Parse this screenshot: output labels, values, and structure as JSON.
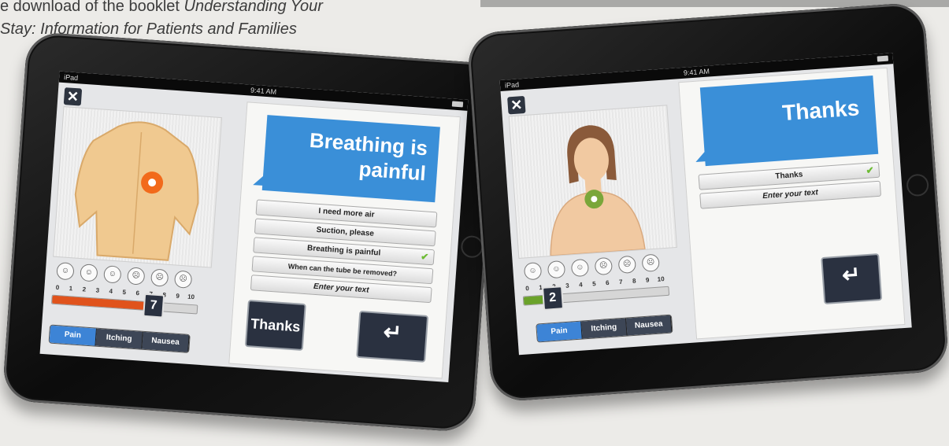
{
  "caption": {
    "line1": "e download of the booklet ",
    "line1_italic": "Understanding Your",
    "line2_italic": "Stay: Information for Patients and Families"
  },
  "left_ipad": {
    "status": {
      "carrier": "iPad",
      "time": "9:41 AM"
    },
    "close_icon": "✕",
    "face_icons": [
      "☺",
      "☺",
      "☺",
      "☹",
      "☹",
      "☹"
    ],
    "scale_numbers": [
      "0",
      "1",
      "2",
      "3",
      "4",
      "5",
      "6",
      "7",
      "8",
      "9",
      "10"
    ],
    "scale_value": 7,
    "scale_color": "#e0531c",
    "tabs": [
      "Pain",
      "Itching",
      "Nausea"
    ],
    "active_tab": "Pain",
    "bubble_text_line1": "Breathing is",
    "bubble_text_line2": "painful",
    "options": [
      "I need more air",
      "Suction, please",
      "Breathing is painful",
      "When can the tube be removed?",
      "Enter your text"
    ],
    "checked_option": "Breathing is painful",
    "thanks_button": "Thanks",
    "back_icon": "return-arrow"
  },
  "right_ipad": {
    "status": {
      "time": "9:41 AM"
    },
    "close_icon": "✕",
    "face_icons": [
      "☺",
      "☺",
      "☺",
      "☹",
      "☹",
      "☹"
    ],
    "scale_numbers": [
      "0",
      "1",
      "2",
      "3",
      "4",
      "5",
      "6",
      "7",
      "8",
      "9",
      "10"
    ],
    "scale_value": 2,
    "scale_color": "#6aa22a",
    "tabs": [
      "Pain",
      "Itching",
      "Nausea"
    ],
    "active_tab": "Pain",
    "bubble_text": "Thanks",
    "options": [
      "Thanks",
      "Enter your text"
    ],
    "checked_option": "Thanks",
    "back_icon": "return-arrow"
  }
}
